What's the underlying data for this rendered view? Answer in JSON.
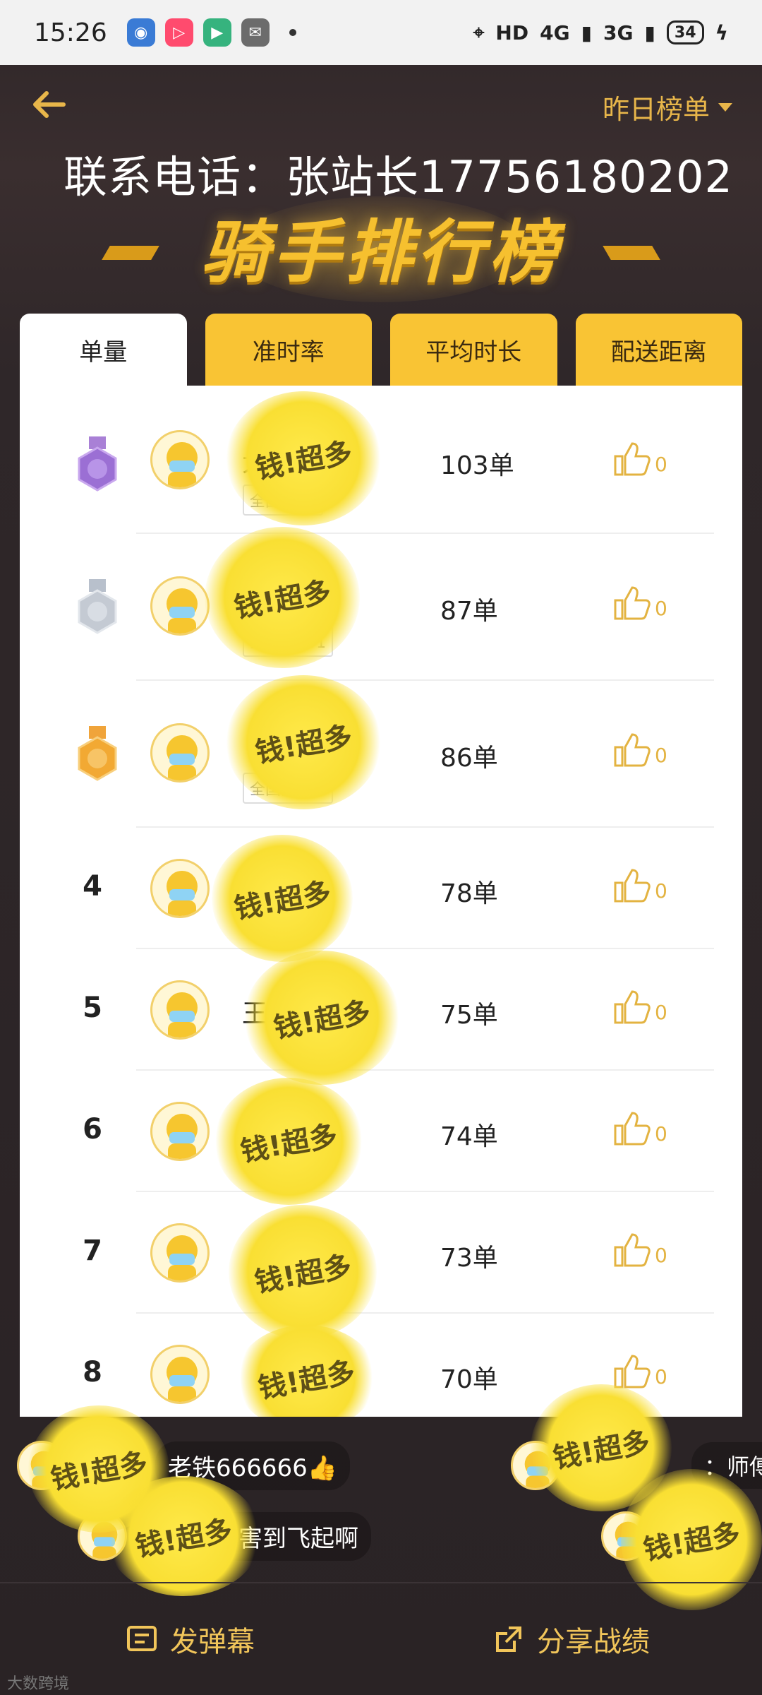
{
  "status_bar": {
    "time": "15:26",
    "network": "HD",
    "signal1": "4G",
    "signal2": "3G",
    "battery": "34"
  },
  "header": {
    "back_icon": "back-arrow-icon",
    "period_label": "昨日榜单",
    "contact_text": "联系电话：张站长17756180202",
    "banner_title": "骑手排行榜"
  },
  "tabs": [
    {
      "label": "单量",
      "active": true
    },
    {
      "label": "准时率",
      "active": false
    },
    {
      "label": "平均时长",
      "active": false
    },
    {
      "label": "配送距离",
      "active": false
    }
  ],
  "rows": [
    {
      "rank": "1",
      "name": "大",
      "national": "全国第73",
      "orders": "103单",
      "likes": "0"
    },
    {
      "rank": "2",
      "name": "",
      "national": "全国第691",
      "orders": "87单",
      "likes": "0"
    },
    {
      "rank": "3",
      "name": "",
      "national": "全国第772",
      "orders": "86单",
      "likes": "0"
    },
    {
      "rank": "4",
      "name": "",
      "national": "",
      "orders": "78单",
      "likes": "0"
    },
    {
      "rank": "5",
      "name": "王",
      "national": "",
      "orders": "75单",
      "likes": "0"
    },
    {
      "rank": "6",
      "name": "",
      "national": "",
      "orders": "74单",
      "likes": "0"
    },
    {
      "rank": "7",
      "name": "",
      "national": "",
      "orders": "73单",
      "likes": "0"
    },
    {
      "rank": "8",
      "name": "",
      "national": "",
      "orders": "70单",
      "likes": "0"
    }
  ],
  "danmaku": [
    {
      "text": "老铁666666👍"
    },
    {
      "text": "厉害到飞起啊"
    },
    {
      "text": "：师傅！等"
    }
  ],
  "sticker_text": "钱!超多",
  "bottom": {
    "danmaku_label": "发弹幕",
    "share_label": "分享战绩"
  },
  "watermark": "大数跨境",
  "colors": {
    "accent": "#f9c434",
    "gold_text": "#e8b64a",
    "background": "#2a2326"
  }
}
